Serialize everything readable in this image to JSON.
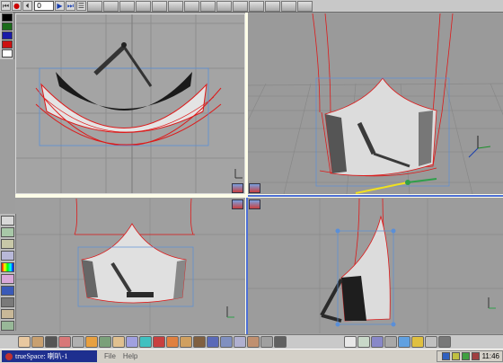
{
  "toolbar": {
    "frame_value": "0",
    "colors": {
      "record": "#cc0000",
      "play": "#1a3fae"
    }
  },
  "palette": {
    "swatches": [
      "#000000",
      "#1a6b1a",
      "#1a1aa8",
      "#cc1111",
      "#ffffff"
    ]
  },
  "viewports": {
    "top_left": {
      "view": "top",
      "wire_color": "#dd1a1a",
      "accent": "#5a8fd8"
    },
    "top_right": {
      "view": "perspective",
      "grid_color": "#7c7c7c",
      "accent_yellow": "#f0e020",
      "accent_green": "#2f9f4a"
    },
    "bottom_left": {
      "view": "front"
    },
    "bottom_right": {
      "view": "side"
    }
  },
  "taskbar": {
    "app_title": "trueSpace: 喇叭-1",
    "menu": [
      "File",
      "Help"
    ],
    "clock": "11:46"
  }
}
